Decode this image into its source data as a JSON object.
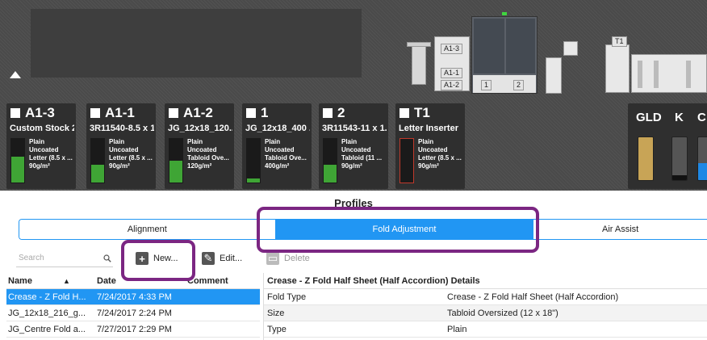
{
  "trays": [
    {
      "id": "A1-3",
      "stock": "Custom Stock 2",
      "lines": [
        "Plain",
        "Uncoated",
        "Letter (8.5 x ...",
        "90g/m²"
      ],
      "level": 0.6,
      "empty": false
    },
    {
      "id": "A1-1",
      "stock": "3R11540-8.5 x 1...",
      "lines": [
        "Plain",
        "Uncoated",
        "Letter (8.5 x ...",
        "90g/m²"
      ],
      "level": 0.4,
      "empty": false
    },
    {
      "id": "A1-2",
      "stock": "JG_12x18_120...",
      "lines": [
        "Plain",
        "Uncoated",
        "Tabloid Ove...",
        "120g/m²"
      ],
      "level": 0.5,
      "empty": false
    },
    {
      "id": "1",
      "stock": "JG_12x18_400 ...",
      "lines": [
        "Plain",
        "Uncoated",
        "Tabloid Ove...",
        "400g/m²"
      ],
      "level": 0.1,
      "empty": false
    },
    {
      "id": "2",
      "stock": "3R11543-11 x 1...",
      "lines": [
        "Plain",
        "Uncoated",
        "Tabloid (11 ...",
        "90g/m²"
      ],
      "level": 0.4,
      "empty": false
    },
    {
      "id": "T1",
      "stock": "Letter Inserter",
      "lines": [
        "Plain",
        "Uncoated",
        "Letter (8.5 x ...",
        "90g/m²"
      ],
      "level": 0,
      "empty": true
    }
  ],
  "toner": [
    {
      "label": "GLD",
      "color": "#c8a456",
      "level": 1.0
    },
    {
      "label": "K",
      "color": "#111111",
      "level": 0.12
    },
    {
      "label": "C",
      "color": "#1e88e5",
      "level": 0.4
    }
  ],
  "printer": {
    "labels": [
      "A1-3",
      "A1-1",
      "A1-2",
      "1",
      "2",
      "T1"
    ]
  },
  "profiles": {
    "title": "Profiles",
    "tabs": [
      {
        "label": "Alignment",
        "active": false
      },
      {
        "label": "Fold Adjustment",
        "active": true
      },
      {
        "label": "Air Assist",
        "active": false
      }
    ],
    "search_placeholder": "Search",
    "new_label": "New...",
    "edit_label": "Edit...",
    "delete_label": "Delete",
    "columns": {
      "name": "Name",
      "date": "Date",
      "comment": "Comment"
    },
    "rows": [
      {
        "name": "Crease - Z Fold H...",
        "date": "7/24/2017 4:33 PM",
        "comment": ""
      },
      {
        "name": "JG_12x18_216_g...",
        "date": "7/24/2017 2:24 PM",
        "comment": ""
      },
      {
        "name": "JG_Centre Fold a...",
        "date": "7/27/2017 2:29 PM",
        "comment": ""
      }
    ],
    "details": {
      "title": "Crease - Z Fold Half Sheet (Half Accordion) Details",
      "rows": [
        {
          "key": "Fold Type",
          "value": "Crease - Z Fold Half Sheet (Half Accordion)"
        },
        {
          "key": "Size",
          "value": "Tabloid Oversized (12 x 18\")"
        },
        {
          "key": "Type",
          "value": "Plain"
        }
      ]
    }
  }
}
